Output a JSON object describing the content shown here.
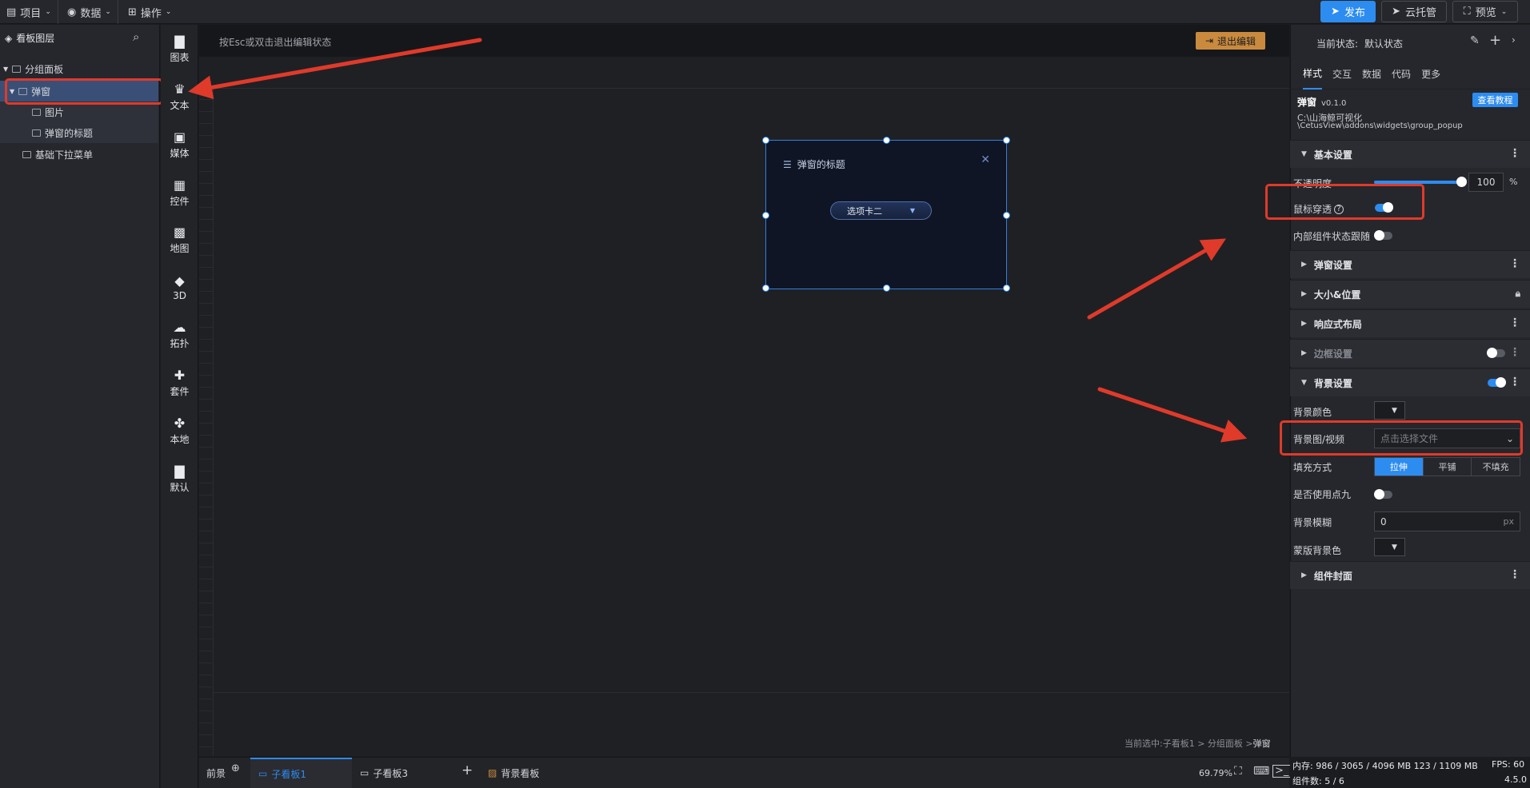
{
  "topbar": {
    "menus": [
      {
        "label": "项目",
        "icon": "file-icon"
      },
      {
        "label": "数据",
        "icon": "database-icon"
      },
      {
        "label": "操作",
        "icon": "grid-icon"
      }
    ],
    "publish_label": "发布",
    "cloud_label": "云托管",
    "preview_label": "预览"
  },
  "layers": {
    "title": "看板图层",
    "items": [
      {
        "label": "分组面板"
      },
      {
        "label": "弹窗"
      },
      {
        "label": "图片"
      },
      {
        "label": "弹窗的标题"
      },
      {
        "label": "基础下拉菜单"
      }
    ]
  },
  "tools": [
    {
      "label": "图表",
      "icon": "chart-icon"
    },
    {
      "label": "文本",
      "icon": "crown-icon"
    },
    {
      "label": "媒体",
      "icon": "media-icon"
    },
    {
      "label": "控件",
      "icon": "widget-icon"
    },
    {
      "label": "地图",
      "icon": "map-icon"
    },
    {
      "label": "3D",
      "icon": "cube-icon"
    },
    {
      "label": "拓扑",
      "icon": "topology-icon"
    },
    {
      "label": "套件",
      "icon": "kit-icon"
    },
    {
      "label": "本地",
      "icon": "puzzle-icon"
    },
    {
      "label": "默认",
      "icon": "default-chart-icon"
    }
  ],
  "canvas": {
    "hint": "按Esc或双击退出编辑状态",
    "exit_label": "退出编辑",
    "popup_title": "弹窗的标题",
    "dropdown_value": "选项卡二",
    "breadcrumb_prefix": "当前选中: ",
    "breadcrumb_path": "子看板1 > 分组面板 > ",
    "breadcrumb_current": "弹窗"
  },
  "bottom": {
    "front_label": "前景",
    "tabs": [
      "子看板1",
      "子看板3"
    ],
    "bg_label": "背景看板",
    "zoom": "69.79%"
  },
  "right": {
    "state_label": "当前状态:",
    "state_value": "默认状态",
    "tabs": [
      "样式",
      "交互",
      "数据",
      "代码",
      "更多"
    ],
    "widget_name": "弹窗",
    "version": "v0.1.0",
    "tutorial_label": "查看教程",
    "path_line1": "C:\\山海鲸可视化",
    "path_line2": "\\CetusView\\addons\\widgets\\group_popup",
    "sections": {
      "basic": "基本设置",
      "popup": "弹窗设置",
      "size": "大小&位置",
      "responsive": "响应式布局",
      "border": "边框设置",
      "background": "背景设置",
      "cover": "组件封面"
    },
    "opacity_label": "不透明度",
    "opacity_value": "100",
    "opacity_unit": "%",
    "opacity_fraction": 1.0,
    "mouse_through_label": "鼠标穿透",
    "mouse_through_on": true,
    "inner_follow_label": "内部组件状态跟随",
    "inner_follow_on": false,
    "border_on": false,
    "background_on": true,
    "bg_color_label": "背景颜色",
    "bg_media_label": "背景图/视频",
    "bg_media_placeholder": "点击选择文件",
    "fill_label": "填充方式",
    "fill_options": [
      "拉伸",
      "平铺",
      "不填充"
    ],
    "fill_selected": "拉伸",
    "nine_patch_label": "是否使用点九",
    "nine_patch_on": false,
    "blur_label": "背景模糊",
    "blur_value": "0",
    "blur_unit": "px",
    "mask_color_label": "蒙版背景色"
  },
  "status": {
    "memory": "内存:  986 / 3065 / 4096 MB  123 / 1109 MB",
    "fps": "FPS:  60",
    "components": "组件数: 5 / 6",
    "version": "4.5.0"
  },
  "colors": {
    "accent": "#2d8cf0",
    "annotation": "#e03a2a",
    "exit_button": "#c98a3e"
  }
}
